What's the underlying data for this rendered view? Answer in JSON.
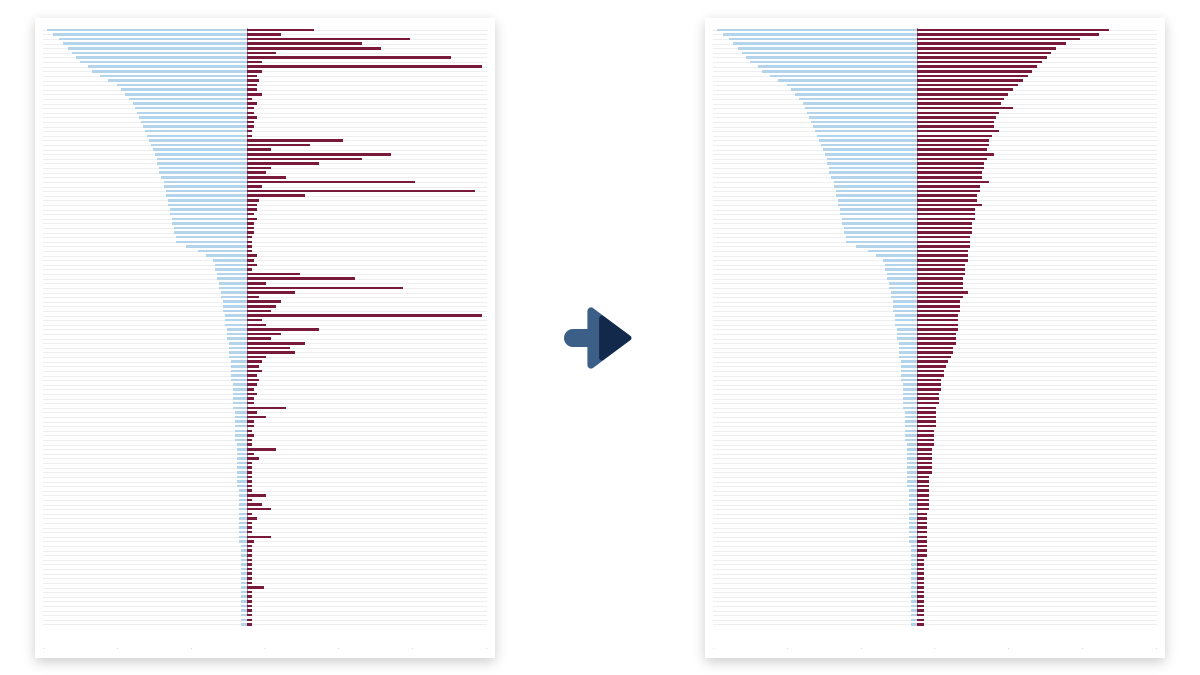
{
  "colors": {
    "blue": "#b3d4ea",
    "red": "#7a1a3a",
    "arrow_outer": "#3b5f87",
    "arrow_inner": "#13294b"
  },
  "chart_data": [
    {
      "type": "bar",
      "orientation": "horizontal",
      "title": "",
      "xlabel": "",
      "ylabel": "",
      "description": "Before: raw diverging horizontal bar chart. Blue bars (series_a) extend left from center axis; maroon bars (series_b) extend right. Values are approximate widths in percent of half-width.",
      "center_axis_pct": 46,
      "n_rows": 130,
      "series": [
        {
          "name": "series_a",
          "color": "#b3d4ea",
          "direction": "left",
          "values": [
            98,
            95,
            92,
            90,
            88,
            86,
            84,
            82,
            78,
            76,
            72,
            68,
            64,
            62,
            60,
            58,
            56,
            55,
            54,
            53,
            52,
            51,
            50,
            49,
            48,
            47,
            46,
            45,
            44,
            44,
            43,
            43,
            42,
            41,
            41,
            40,
            40,
            39,
            39,
            38,
            38,
            37,
            37,
            36,
            36,
            35,
            35,
            30,
            24,
            20,
            17,
            16,
            16,
            15,
            15,
            14,
            14,
            13,
            13,
            12,
            12,
            12,
            11,
            11,
            11,
            10,
            10,
            10,
            9,
            9,
            9,
            9,
            8,
            8,
            8,
            8,
            8,
            7,
            7,
            7,
            7,
            7,
            7,
            6,
            6,
            6,
            6,
            6,
            6,
            6,
            5,
            5,
            5,
            5,
            5,
            5,
            5,
            5,
            5,
            5,
            4,
            4,
            4,
            4,
            4,
            4,
            4,
            4,
            4,
            4,
            4,
            4,
            3,
            3,
            3,
            3,
            3,
            3,
            3,
            3,
            3,
            3,
            3,
            3,
            3,
            3,
            3,
            3,
            3,
            3
          ]
        },
        {
          "name": "series_b",
          "color": "#7a1a3a",
          "direction": "right",
          "values": [
            28,
            14,
            68,
            48,
            56,
            12,
            85,
            6,
            98,
            6,
            4,
            5,
            4,
            4,
            6,
            2,
            4,
            3,
            3,
            4,
            3,
            3,
            2,
            2,
            40,
            26,
            10,
            60,
            48,
            30,
            10,
            8,
            16,
            70,
            6,
            95,
            24,
            5,
            4,
            4,
            3,
            4,
            3,
            3,
            3,
            2,
            2,
            2,
            2,
            4,
            3,
            4,
            2,
            22,
            45,
            8,
            65,
            20,
            5,
            14,
            12,
            10,
            98,
            6,
            8,
            30,
            14,
            10,
            24,
            18,
            20,
            8,
            6,
            5,
            6,
            4,
            5,
            4,
            3,
            4,
            3,
            3,
            16,
            4,
            8,
            3,
            3,
            2,
            3,
            2,
            2,
            12,
            3,
            5,
            2,
            2,
            2,
            2,
            2,
            2,
            2,
            8,
            2,
            6,
            10,
            2,
            4,
            2,
            2,
            2,
            10,
            3,
            2,
            2,
            2,
            2,
            2,
            2,
            2,
            2,
            2,
            7,
            2,
            2,
            2,
            2,
            2,
            2,
            2,
            2
          ]
        }
      ]
    },
    {
      "type": "bar",
      "orientation": "horizontal",
      "title": "",
      "xlabel": "",
      "ylabel": "",
      "description": "After: sorted/smoothed diverging horizontal bar chart. Both series now monotonically decrease from top to bottom with far less jaggedness on the right.",
      "center_axis_pct": 46,
      "n_rows": 130,
      "series": [
        {
          "name": "series_a",
          "color": "#b3d4ea",
          "direction": "left",
          "values": [
            98,
            95,
            92,
            90,
            88,
            86,
            84,
            82,
            78,
            76,
            72,
            68,
            64,
            62,
            60,
            58,
            56,
            55,
            54,
            53,
            52,
            51,
            50,
            49,
            48,
            47,
            46,
            45,
            44,
            44,
            43,
            43,
            42,
            41,
            41,
            40,
            40,
            39,
            39,
            38,
            38,
            37,
            37,
            36,
            36,
            35,
            35,
            30,
            24,
            20,
            17,
            16,
            16,
            15,
            15,
            14,
            14,
            13,
            13,
            12,
            12,
            12,
            11,
            11,
            11,
            10,
            10,
            10,
            9,
            9,
            9,
            9,
            8,
            8,
            8,
            8,
            8,
            7,
            7,
            7,
            7,
            7,
            7,
            6,
            6,
            6,
            6,
            6,
            6,
            6,
            5,
            5,
            5,
            5,
            5,
            5,
            5,
            5,
            5,
            5,
            4,
            4,
            4,
            4,
            4,
            4,
            4,
            4,
            4,
            4,
            4,
            4,
            3,
            3,
            3,
            3,
            3,
            3,
            3,
            3,
            3,
            3,
            3,
            3,
            3,
            3,
            3,
            3,
            3,
            3
          ]
        },
        {
          "name": "series_b",
          "color": "#7a1a3a",
          "direction": "right",
          "values": [
            80,
            76,
            68,
            62,
            58,
            56,
            54,
            52,
            50,
            48,
            46,
            44,
            42,
            40,
            38,
            36,
            35,
            40,
            34,
            33,
            32,
            32,
            34,
            31,
            30,
            30,
            29,
            32,
            29,
            28,
            28,
            27,
            27,
            30,
            26,
            26,
            25,
            25,
            27,
            24,
            24,
            24,
            23,
            23,
            23,
            22,
            22,
            22,
            21,
            21,
            21,
            20,
            20,
            20,
            19,
            19,
            19,
            21,
            19,
            18,
            18,
            18,
            17,
            17,
            17,
            17,
            16,
            16,
            16,
            15,
            15,
            14,
            13,
            12,
            11,
            11,
            10,
            10,
            10,
            9,
            9,
            9,
            8,
            8,
            8,
            8,
            8,
            7,
            7,
            7,
            7,
            6,
            6,
            6,
            6,
            6,
            6,
            5,
            5,
            5,
            5,
            5,
            5,
            5,
            5,
            4,
            4,
            4,
            4,
            4,
            4,
            4,
            4,
            4,
            4,
            3,
            3,
            3,
            3,
            3,
            3,
            3,
            3,
            3,
            3,
            3,
            3,
            3,
            3,
            3
          ]
        }
      ]
    }
  ],
  "arrow_label": "transforms to"
}
